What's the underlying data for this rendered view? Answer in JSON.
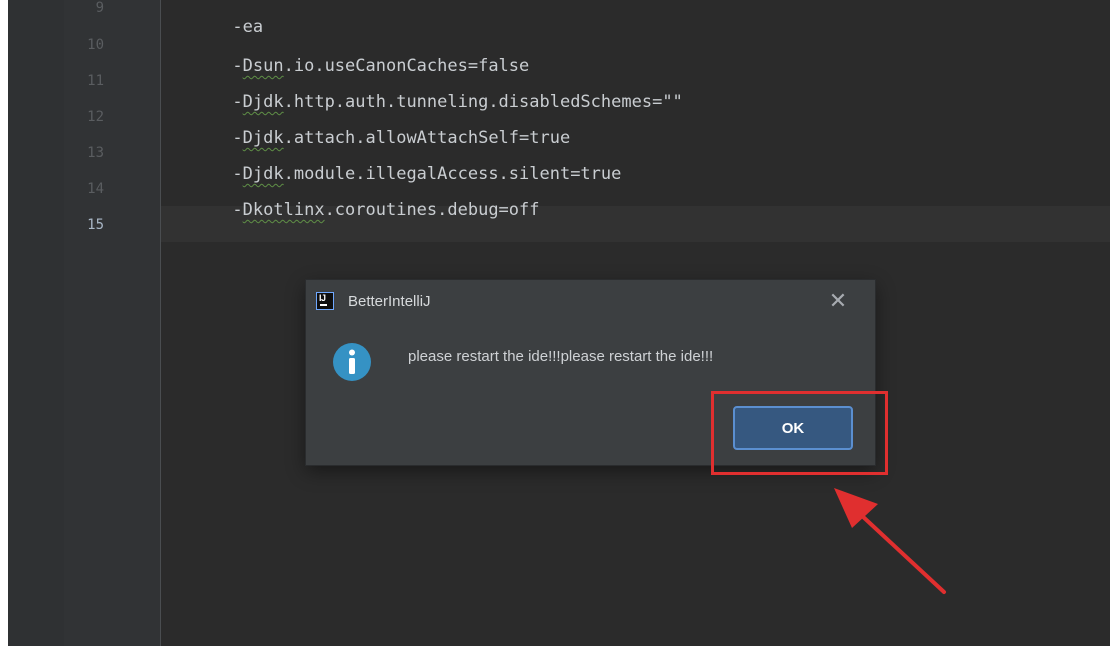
{
  "editor": {
    "lines": [
      {
        "number": "9",
        "text": "-ea",
        "current": false
      },
      {
        "number": "10",
        "text_prefix": "-",
        "text_flag": "Dsun",
        "text_rest": ".io.useCanonCaches=false",
        "current": false
      },
      {
        "number": "11",
        "text_prefix": "-",
        "text_flag": "Djdk",
        "text_rest": ".http.auth.tunneling.disabledSchemes=\"\"",
        "current": false
      },
      {
        "number": "12",
        "text_prefix": "-",
        "text_flag": "Djdk",
        "text_rest": ".attach.allowAttachSelf=true",
        "current": false
      },
      {
        "number": "13",
        "text_prefix": "-",
        "text_flag": "Djdk",
        "text_rest": ".module.illegalAccess.silent=true",
        "current": false
      },
      {
        "number": "14",
        "text_prefix": "-",
        "text_flag": "Dkotlinx",
        "text_rest": ".coroutines.debug=off",
        "current": false
      },
      {
        "number": "15",
        "text": "",
        "current": true
      }
    ]
  },
  "dialog": {
    "title": "BetterIntelliJ",
    "app_icon_text": "IJ",
    "message": "please restart the ide!!!please restart the ide!!!",
    "ok_label": "OK",
    "close_glyph": "✕",
    "info_icon_glyph": "i"
  },
  "colors": {
    "annotation_red": "#e02f2f",
    "ok_button_bg": "#365880",
    "info_icon_blue": "#3592c4"
  }
}
